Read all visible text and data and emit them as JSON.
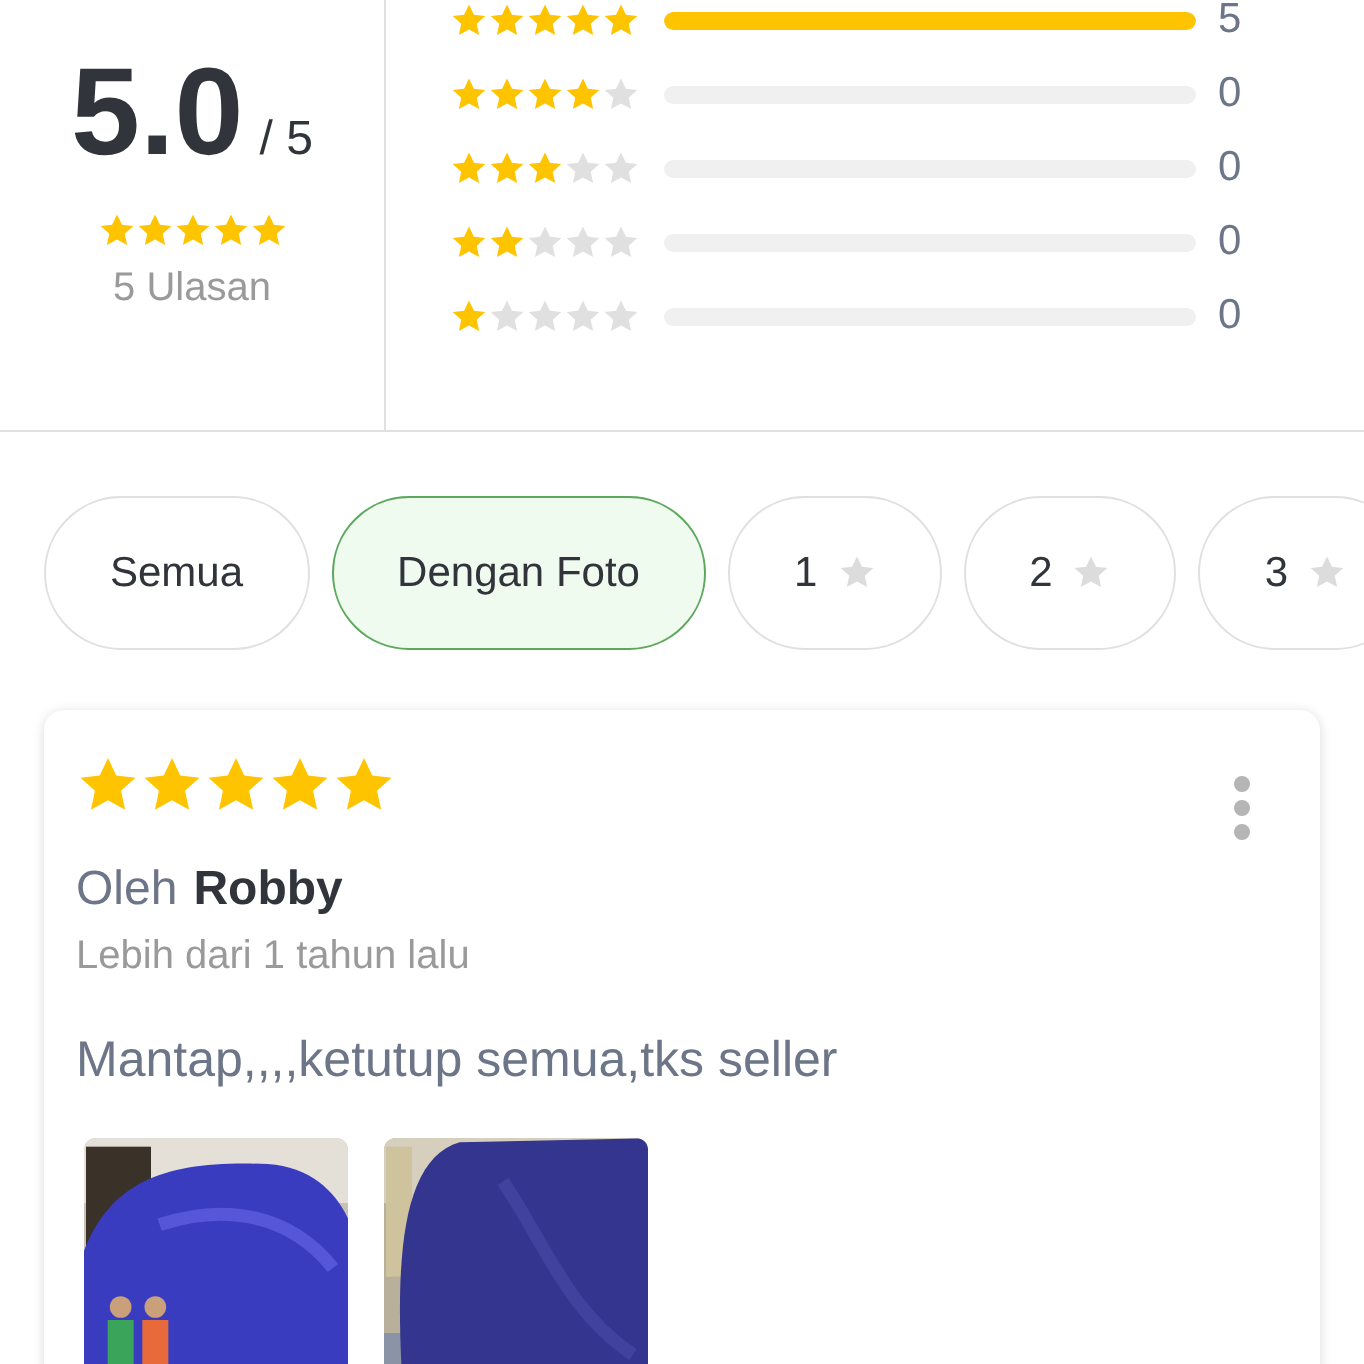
{
  "summary": {
    "score": "5.0",
    "out_of": "/ 5",
    "stars": 5,
    "review_count": "5 Ulasan"
  },
  "breakdown": [
    {
      "stars": 5,
      "level": 1,
      "count": "5"
    },
    {
      "stars": 4,
      "level": 0,
      "count": "0"
    },
    {
      "stars": 3,
      "level": 0,
      "count": "0"
    },
    {
      "stars": 2,
      "level": 0,
      "count": "0"
    },
    {
      "stars": 1,
      "level": 0,
      "count": "0"
    }
  ],
  "filters": [
    {
      "kind": "text",
      "label": "Semua",
      "selected": false
    },
    {
      "kind": "text",
      "label": "Dengan Foto",
      "selected": true
    },
    {
      "kind": "star",
      "label": "1",
      "selected": false
    },
    {
      "kind": "star",
      "label": "2",
      "selected": false
    },
    {
      "kind": "star",
      "label": "3",
      "selected": false
    }
  ],
  "review": {
    "stars": 5,
    "by_label": "Oleh",
    "author": "Robby",
    "time": "Lebih dari 1 tahun lalu",
    "text": "Mantap,,,,ketutup semua,tks seller",
    "photos": [
      {
        "kind": "picture"
      },
      {
        "kind": "picture"
      }
    ]
  }
}
